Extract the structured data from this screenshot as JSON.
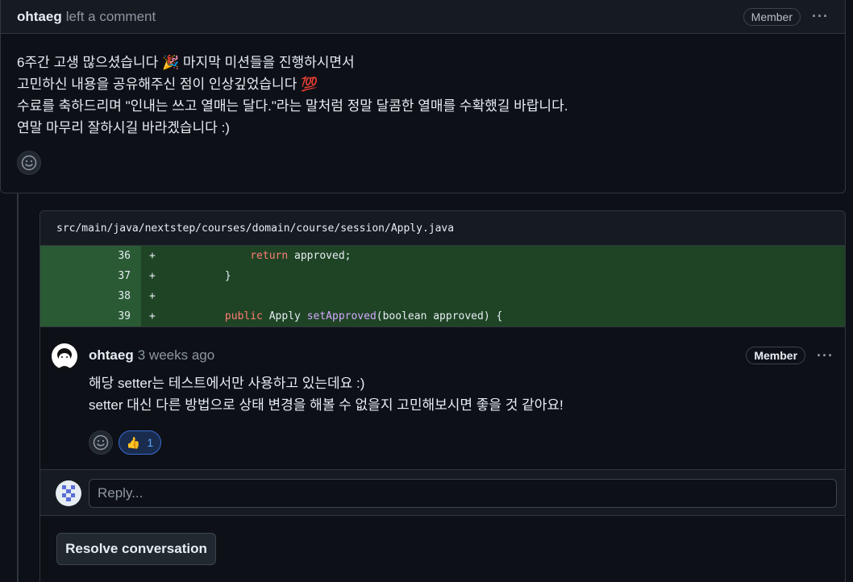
{
  "top_comment": {
    "author": "ohtaeg",
    "action": "left a comment",
    "role_badge": "Member",
    "more_icon": "kebab-horizontal-icon",
    "lines": [
      "6주간 고생 많으셨습니다 🎉 마지막 미션들을 진행하시면서",
      "고민하신 내용을 공유해주신 점이 인상깊었습니다 💯",
      "수료를 축하드리며 \"인내는 쓰고 열매는 달다.\"라는 말처럼 정말 달콤한 열매를 수확했길 바랍니다.",
      "연말 마무리 잘하시길 바라겠습니다 :)"
    ],
    "reaction_icon": "smiley-icon"
  },
  "review": {
    "file_path": "src/main/java/nextstep/courses/domain/course/session/Apply.java",
    "diff": [
      {
        "line": "36",
        "sign": "+",
        "indent": "        ",
        "tokens": [
          {
            "t": "return",
            "k": "kw"
          },
          {
            "t": " approved;",
            "k": ""
          }
        ]
      },
      {
        "line": "37",
        "sign": "+",
        "indent": "    ",
        "tokens": [
          {
            "t": "}",
            "k": ""
          }
        ]
      },
      {
        "line": "38",
        "sign": "+",
        "indent": "",
        "tokens": []
      },
      {
        "line": "39",
        "sign": "+",
        "indent": "    ",
        "tokens": [
          {
            "t": "public",
            "k": "kw"
          },
          {
            "t": " Apply ",
            "k": ""
          },
          {
            "t": "setApproved",
            "k": "fn"
          },
          {
            "t": "(boolean approved) {",
            "k": ""
          }
        ]
      }
    ],
    "comment": {
      "author": "ohtaeg",
      "time": "3 weeks ago",
      "role_badge": "Member",
      "lines": [
        "해당 setter는 테스트에서만 사용하고 있는데요 :)",
        "setter 대신 다른 방법으로 상태 변경을 해볼 수 없을지 고민해보시면 좋을 것 같아요!"
      ],
      "reaction": {
        "emoji": "👍",
        "count": "1"
      }
    },
    "reply_placeholder": "Reply...",
    "resolve_label": "Resolve conversation"
  }
}
